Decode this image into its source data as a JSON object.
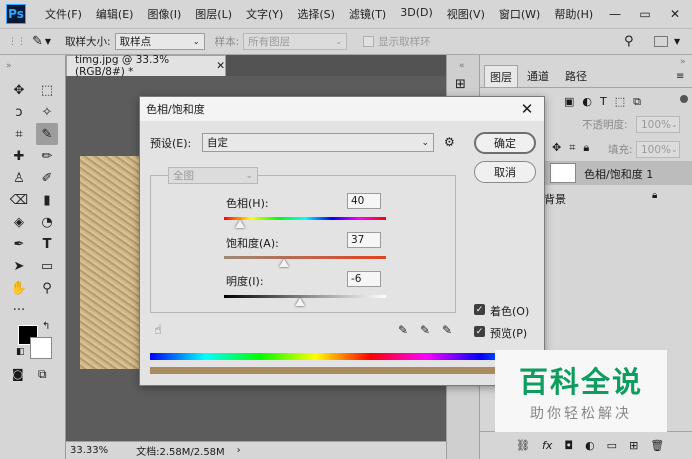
{
  "app": {
    "logo": "Ps"
  },
  "menu": [
    "文件(F)",
    "编辑(E)",
    "图像(I)",
    "图层(L)",
    "文字(Y)",
    "选择(S)",
    "滤镜(T)",
    "3D(D)",
    "视图(V)",
    "窗口(W)",
    "帮助(H)"
  ],
  "options": {
    "sample_size_label": "取样大小:",
    "sample_size_value": "取样点",
    "sample_label": "样本:",
    "sample_value": "所有图层",
    "show_ring_label": "显示取样环"
  },
  "document": {
    "tab_title": "timg.jpg @ 33.3%(RGB/8#) *",
    "zoom": "33.33%",
    "doc_info": "文档:2.58M/2.58M"
  },
  "layers_panel": {
    "tabs": [
      "图层",
      "通道",
      "路径"
    ],
    "opacity_label": "不透明度:",
    "opacity_value": "100%",
    "fill_label": "填充:",
    "fill_value": "100%",
    "layers": [
      {
        "name": "色相/饱和度 1"
      },
      {
        "name": "背景"
      }
    ]
  },
  "dialog": {
    "title": "色相/饱和度",
    "preset_label": "预设(E):",
    "preset_value": "自定",
    "channel_value": "全图",
    "ok_label": "确定",
    "cancel_label": "取消",
    "hue_label": "色相(H):",
    "hue_value": "40",
    "saturation_label": "饱和度(A):",
    "saturation_value": "37",
    "lightness_label": "明度(I):",
    "lightness_value": "-6",
    "colorize_label": "着色(O)",
    "colorize_checked": true,
    "preview_label": "预览(P)",
    "preview_checked": true
  },
  "watermark": {
    "title": "百科全说",
    "subtitle": "助你轻松解决"
  }
}
